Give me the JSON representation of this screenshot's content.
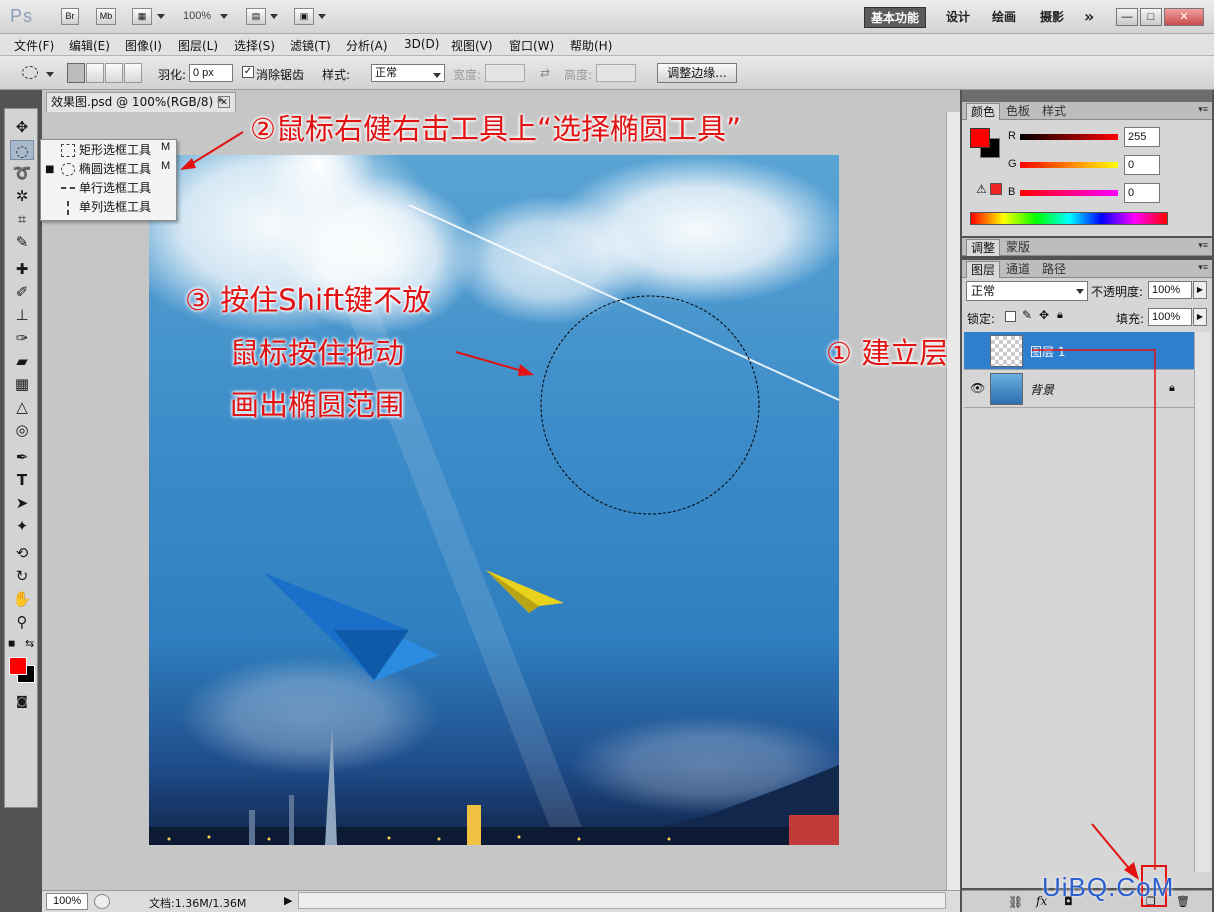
{
  "app": {
    "logo": "Ps",
    "quick_buttons": [
      "Br",
      "Mb"
    ],
    "zoom_display": "100%",
    "workspaces": [
      "基本功能",
      "设计",
      "绘画",
      "摄影"
    ],
    "more": "»",
    "window_buttons": [
      "—",
      "□",
      "✕"
    ]
  },
  "menu": [
    "文件(F)",
    "编辑(E)",
    "图像(I)",
    "图层(L)",
    "选择(S)",
    "滤镜(T)",
    "分析(A)",
    "3D(D)",
    "视图(V)",
    "窗口(W)",
    "帮助(H)"
  ],
  "options": {
    "feather_label": "羽化:",
    "feather_value": "0 px",
    "antialias_label": "消除锯齿",
    "antialias_checked": true,
    "style_label": "样式:",
    "style_value": "正常",
    "width_label": "宽度:",
    "height_label": "高度:",
    "refine_edge": "调整边缘..."
  },
  "flyout": {
    "items": [
      {
        "label": "矩形选框工具",
        "key": "M",
        "selected": false,
        "shape": "rect"
      },
      {
        "label": "椭圆选框工具",
        "key": "M",
        "selected": true,
        "shape": "ellipse"
      },
      {
        "label": "单行选框工具",
        "key": "",
        "selected": false,
        "shape": "row"
      },
      {
        "label": "单列选框工具",
        "key": "",
        "selected": false,
        "shape": "col"
      }
    ]
  },
  "document": {
    "tab_title": "效果图.psd @ 100%(RGB/8) *",
    "zoom": "100%",
    "doc_size": "文档:1.36M/1.36M"
  },
  "annotations": {
    "step2": "②鼠标右健右击工具上“选择椭圆工具”",
    "step3_line1": "③ 按住Shift键不放",
    "step3_line2": "鼠标按住拖动",
    "step3_line3": "画出椭圆范围",
    "step1": "① 建立层"
  },
  "color_panel": {
    "tabs": [
      "颜色",
      "色板",
      "样式"
    ],
    "channels": [
      {
        "label": "R",
        "value": "255"
      },
      {
        "label": "G",
        "value": "0"
      },
      {
        "label": "B",
        "value": "0"
      }
    ],
    "foreground": "#ff0000",
    "background": "#000000"
  },
  "adjust_panel": {
    "tabs": [
      "调整",
      "蒙版"
    ]
  },
  "layers_panel": {
    "tabs": [
      "图层",
      "通道",
      "路径"
    ],
    "blend_mode": "正常",
    "opacity_label": "不透明度:",
    "opacity_value": "100%",
    "lock_label": "锁定:",
    "fill_label": "填充:",
    "fill_value": "100%",
    "layers": [
      {
        "name": "图层 1",
        "selected": true,
        "visible": false,
        "locked": false
      },
      {
        "name": "背景",
        "selected": false,
        "visible": true,
        "locked": true
      }
    ]
  },
  "watermark": "UiBQ.CoM",
  "colors": {
    "accent": "#1a6fc9",
    "annotation": "#e21212",
    "selected_layer": "#2f7fcf"
  }
}
